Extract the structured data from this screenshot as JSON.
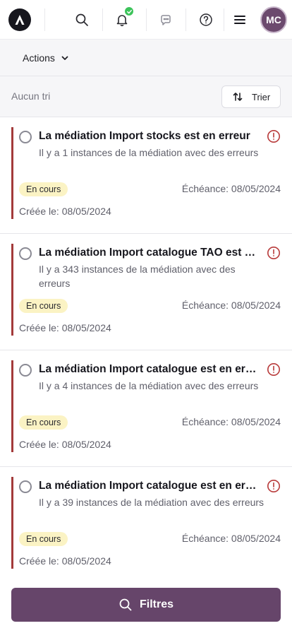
{
  "header": {
    "avatar_initials": "MC",
    "icons": [
      "app-logo-icon",
      "search-icon",
      "bell-icon",
      "chat-icon",
      "help-icon",
      "menu-icon"
    ],
    "notification_status_color": "#3cc35a"
  },
  "actions": {
    "label": "Actions"
  },
  "sort": {
    "label": "Aucun tri",
    "button_label": "Trier"
  },
  "cards": [
    {
      "title": "La médiation Import stocks est en erreur",
      "description": "Il y a 1 instances de la médiation avec des erreurs",
      "status": "En cours",
      "due": "Échéance: 08/05/2024",
      "created": "Créée le: 08/05/2024"
    },
    {
      "title": "La médiation Import catalogue TAO est en erreur",
      "description": "Il y a 343 instances de la médiation avec des erreurs",
      "status": "En cours",
      "due": "Échéance: 08/05/2024",
      "created": "Créée le: 08/05/2024"
    },
    {
      "title": "La médiation Import catalogue est en erreur",
      "description": "Il y a 4 instances de la médiation avec des erreurs",
      "status": "En cours",
      "due": "Échéance: 08/05/2024",
      "created": "Créée le: 08/05/2024"
    },
    {
      "title": "La médiation Import catalogue est en erreur",
      "description": "Il y a 39 instances de la médiation avec des erreurs",
      "status": "En cours",
      "due": "Échéance: 08/05/2024",
      "created": "Créée le: 08/05/2024"
    }
  ],
  "footer": {
    "filters_label": "Filtres"
  },
  "colors": {
    "brand": "#66456a",
    "error_bar": "#a33a3a",
    "status_badge_bg": "#fbf3c4"
  }
}
